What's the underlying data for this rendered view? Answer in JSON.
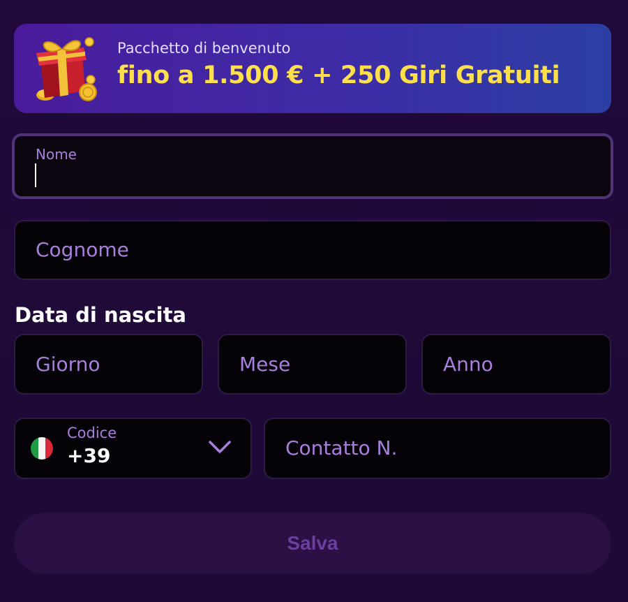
{
  "banner": {
    "subtitle": "Pacchetto di benvenuto",
    "title": "fino a 1.500 € + 250 Giri Gratuiti",
    "icon": "gift-box-icon"
  },
  "form": {
    "first_name": {
      "label": "Nome",
      "value": ""
    },
    "last_name": {
      "placeholder": "Cognome",
      "value": ""
    },
    "birth_date": {
      "label": "Data di nascita",
      "day_placeholder": "Giorno",
      "month_placeholder": "Mese",
      "year_placeholder": "Anno"
    },
    "phone": {
      "code_label": "Codice",
      "code_value": "+39",
      "flag": "italy-flag-icon",
      "number_placeholder": "Contatto N."
    },
    "save_label": "Salva"
  },
  "colors": {
    "background": "#1e0b36",
    "accent_text": "#a77fdc",
    "banner_title": "#ffe04a",
    "save_button_bg": "#2a1045",
    "save_button_text": "#6a3f9e"
  }
}
